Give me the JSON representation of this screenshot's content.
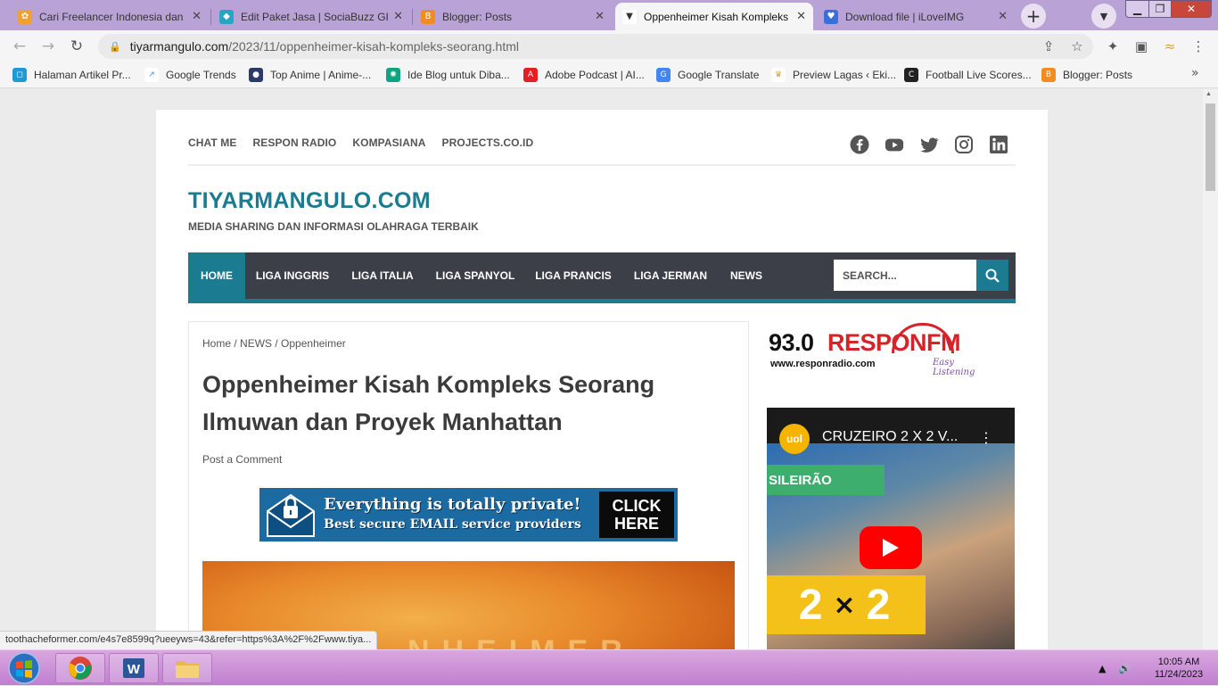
{
  "browser": {
    "tabs": [
      {
        "title": "Cari Freelancer Indonesia dan F",
        "active": false,
        "favicon_color": "#f0a030"
      },
      {
        "title": "Edit Paket Jasa | SociaBuzz GIG",
        "active": false,
        "favicon_color": "#2aa4c4"
      },
      {
        "title": "Blogger: Posts",
        "active": false,
        "favicon_color": "#f28b20"
      },
      {
        "title": "Oppenheimer Kisah Kompleks",
        "active": true,
        "favicon_color": "#333333"
      },
      {
        "title": "Download file | iLoveIMG",
        "active": false,
        "favicon_color": "#3a6fd8"
      }
    ],
    "url_host": "tiyarmangulo.com",
    "url_path": "/2023/11/oppenheimer-kisah-kompleks-seorang.html",
    "bookmarks": [
      {
        "label": "Halaman Artikel Pr...",
        "icon_color": "#1e9bd7"
      },
      {
        "label": "Google Trends",
        "icon_color": "#4285f4"
      },
      {
        "label": "Top Anime | Anime-...",
        "icon_color": "#2b3a67"
      },
      {
        "label": "Ide Blog untuk Diba...",
        "icon_color": "#10a37f"
      },
      {
        "label": "Adobe Podcast | AI...",
        "icon_color": "#e31e24"
      },
      {
        "label": "Google Translate",
        "icon_color": "#4285f4"
      },
      {
        "label": "Preview Lagas ‹ Eki...",
        "icon_color": "#d9a520"
      },
      {
        "label": "Football Live Scores...",
        "icon_color": "#222222"
      },
      {
        "label": "Blogger: Posts",
        "icon_color": "#f28b20"
      }
    ],
    "status_url": "toothacheformer.com/e4s7e8599q?ueeyws=43&refer=https%3A%2F%2Fwww.tiya..."
  },
  "site": {
    "top_menu": [
      "CHAT ME",
      "RESPON RADIO",
      "KOMPASIANA",
      "PROJECTS.CO.ID"
    ],
    "social_icons": [
      "facebook-icon",
      "youtube-icon",
      "twitter-icon",
      "instagram-icon",
      "linkedin-icon"
    ],
    "title": "TIYARMANGULO.COM",
    "description": "MEDIA SHARING DAN INFORMASI OLAHRAGA TERBAIK",
    "nav": [
      "HOME",
      "LIGA INGGRIS",
      "LIGA ITALIA",
      "LIGA SPANYOL",
      "LIGA PRANCIS",
      "LIGA JERMAN",
      "NEWS"
    ],
    "search_placeholder": "SEARCH...",
    "accent_color": "#1a7b91",
    "nav_bg_color": "#3d3f48"
  },
  "article": {
    "breadcrumb": {
      "home": "Home",
      "sep": " / ",
      "category": "NEWS",
      "label": "Oppenheimer"
    },
    "title": "Oppenheimer Kisah Kompleks Seorang Ilmuwan dan Proyek Manhattan",
    "comment_link": "Post a Comment",
    "ad": {
      "line1": "Everything is totally private!",
      "line2": "Best secure EMAIL service providers",
      "cta_line1": "CLICK",
      "cta_line2": "HERE"
    },
    "hero_text": "NHEIMER"
  },
  "sidebar": {
    "radio_number": "93.0",
    "radio_brand": "RESPONFM",
    "radio_url": "www.responradio.com",
    "radio_tagline": "Easy Listening",
    "video": {
      "channel": "uol",
      "title": "CRUZEIRO 2 X 2 V...",
      "tag": "SILEIRÃO",
      "score_left": "2",
      "score_sep": "×",
      "score_right": "2"
    }
  },
  "taskbar": {
    "time": "10:05 AM",
    "date": "11/24/2023"
  }
}
